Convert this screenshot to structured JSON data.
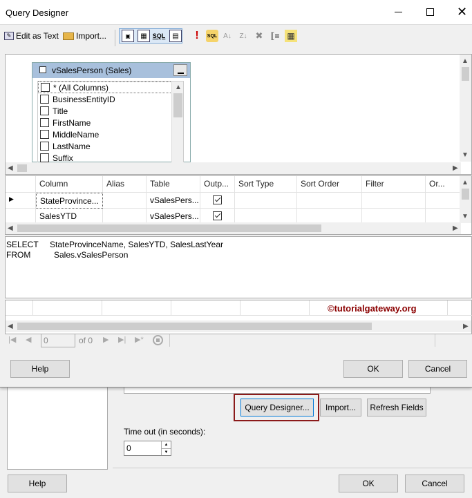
{
  "background_dialog": {
    "query_designer_label": "Query Designer...",
    "import_label": "Import...",
    "refresh_label": "Refresh Fields",
    "timeout_label": "Time out (in seconds):",
    "timeout_value": "0",
    "help_label": "Help",
    "ok_label": "OK",
    "cancel_label": "Cancel"
  },
  "window": {
    "title": "Query Designer"
  },
  "toolbar": {
    "edit_as_text": "Edit as Text",
    "import": "Import..."
  },
  "table_box": {
    "title": "vSalesPerson (Sales)",
    "columns": [
      "* (All Columns)",
      "BusinessEntityID",
      "Title",
      "FirstName",
      "MiddleName",
      "LastName",
      "Suffix"
    ]
  },
  "grid": {
    "headers": [
      "Column",
      "Alias",
      "Table",
      "Outp...",
      "Sort Type",
      "Sort Order",
      "Filter",
      "Or..."
    ],
    "rows": [
      {
        "column": "StateProvince...",
        "alias": "",
        "table": "vSalesPers...",
        "output": true
      },
      {
        "column": "SalesYTD",
        "alias": "",
        "table": "vSalesPers...",
        "output": true
      }
    ]
  },
  "sql": {
    "line1_keyword": "SELECT",
    "line1_text": "StateProvinceName, SalesYTD, SalesLastYear",
    "line2_keyword": "FROM",
    "line2_text": "Sales.vSalesPerson"
  },
  "results": {
    "watermark": "©tutorialgateway.org",
    "watermark_color": "#8b0000"
  },
  "navigator": {
    "page_value": "0",
    "of_label": "of 0"
  },
  "footer": {
    "help_label": "Help",
    "ok_label": "OK",
    "cancel_label": "Cancel"
  },
  "colors": {
    "highlight_box": "#8b1a1a",
    "table_title_bg": "#a8c0dc"
  }
}
